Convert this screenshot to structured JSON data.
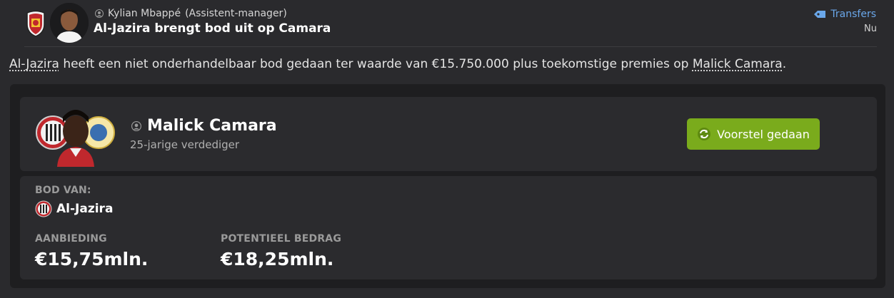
{
  "header": {
    "sender_name": "Kylian Mbappé",
    "sender_role": "(Assistent-manager)",
    "title": "Al-Jazira brengt bod uit op Camara",
    "category_link": "Transfers",
    "time": "Nu"
  },
  "message": {
    "club_link": "Al-Jazira",
    "text_middle": " heeft een niet onderhandelbaar bod gedaan ter waarde van €15.750.000 plus toekomstige premies op ",
    "player_link": "Malick Camara",
    "text_end": "."
  },
  "player": {
    "name": "Malick Camara",
    "description": "25-jarige verdediger"
  },
  "action": {
    "button_label": "Voorstel gedaan"
  },
  "offer": {
    "from_label": "BOD VAN:",
    "club_name": "Al-Jazira",
    "offer_label": "AANBIEDING",
    "offer_value": "€15,75mln.",
    "potential_label": "POTENTIEEL BEDRAG",
    "potential_value": "€18,25mln."
  },
  "colors": {
    "accent_link": "#6aa7ea",
    "button_green": "#7aab1c"
  },
  "icons": [
    "person-icon",
    "tag-icon",
    "refresh-icon",
    "club-crest"
  ]
}
